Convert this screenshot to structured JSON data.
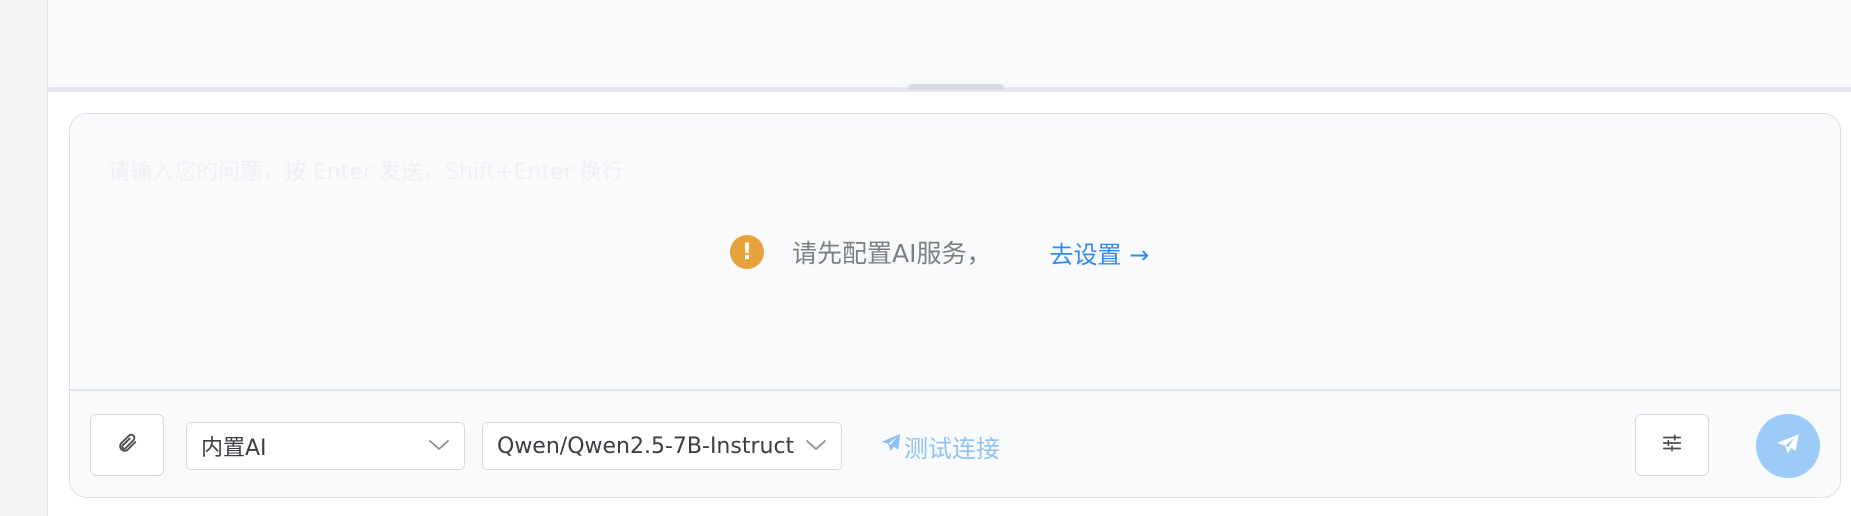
{
  "input": {
    "placeholder": "请输入您的问题，按 Enter 发送，Shift+Enter 换行"
  },
  "notice": {
    "text": "请先配置AI服务，",
    "link_text": "去设置 →"
  },
  "toolbar": {
    "provider_value": "内置AI",
    "model_value": "Qwen/Qwen2.5-7B-Instruct",
    "test_connection_label": "测试连接"
  },
  "icons": {
    "warning": "warning-icon",
    "attach": "paperclip-icon",
    "dropdown": "chevron-down-icon",
    "test": "paper-plane-icon",
    "settings": "sliders-icon",
    "send": "send-icon"
  },
  "colors": {
    "warning": "#e6a23c",
    "link": "#2f8cf5",
    "test_link": "#8fc3f7",
    "send_button": "#9dcbf8"
  }
}
